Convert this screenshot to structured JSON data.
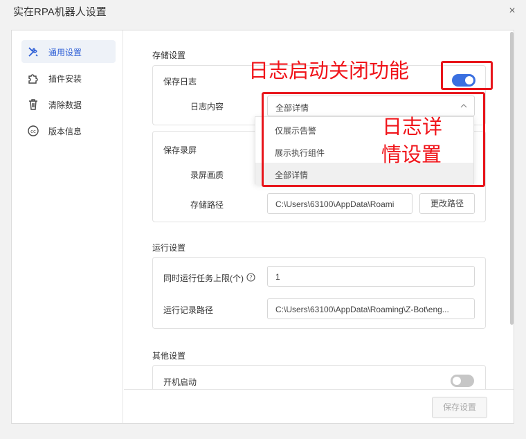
{
  "window": {
    "title": "实在RPA机器人设置",
    "close_label": "×"
  },
  "sidebar": {
    "items": [
      {
        "label": "通用设置",
        "icon": "tools-icon",
        "active": true
      },
      {
        "label": "插件安装",
        "icon": "puzzle-icon",
        "active": false
      },
      {
        "label": "清除数据",
        "icon": "trash-icon",
        "active": false
      },
      {
        "label": "版本信息",
        "icon": "copyright-icon",
        "active": false
      }
    ]
  },
  "storage": {
    "section_title": "存储设置",
    "save_log_label": "保存日志",
    "save_log_enabled": true,
    "log_content_label": "日志内容",
    "log_content_value": "全部详情",
    "log_options": [
      "仅展示告警",
      "展示执行组件",
      "全部详情"
    ],
    "save_screen_label": "保存录屏",
    "screen_quality_label": "录屏画质",
    "storage_path_label": "存储路径",
    "storage_path_value": "C:\\Users\\63100\\AppData\\Roami",
    "change_path_label": "更改路径"
  },
  "run": {
    "section_title": "运行设置",
    "max_tasks_label": "同时运行任务上限(个)",
    "max_tasks_value": "1",
    "log_path_label": "运行记录路径",
    "log_path_value": "C:\\Users\\63100\\AppData\\Roaming\\Z-Bot\\eng..."
  },
  "other": {
    "section_title": "其他设置",
    "autostart_label": "开机启动",
    "autostart_enabled": false
  },
  "footer": {
    "save_label": "保存设置"
  },
  "annotations": {
    "toggle_note": "日志启动关闭功能",
    "dropdown_note_line1": "日志详",
    "dropdown_note_line2": "情设置"
  },
  "colors": {
    "accent": "#3a6fe0",
    "annotation": "#e8151b"
  }
}
